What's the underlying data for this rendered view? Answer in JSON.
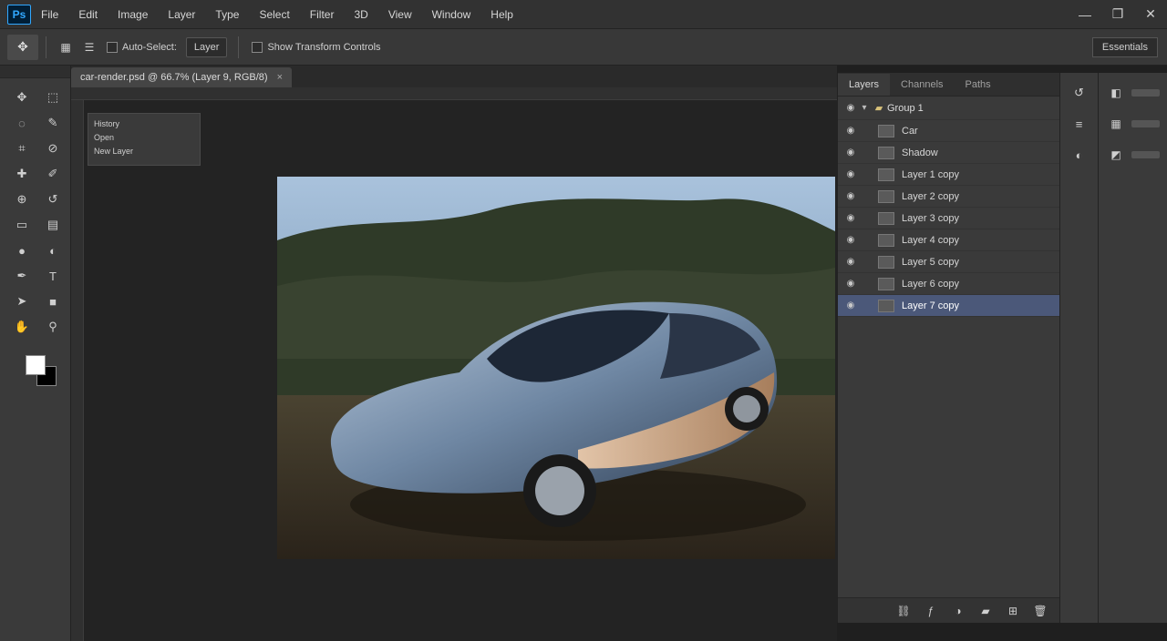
{
  "app": {
    "logo": "Ps"
  },
  "menu": [
    "File",
    "Edit",
    "Image",
    "Layer",
    "Type",
    "Select",
    "Filter",
    "3D",
    "View",
    "Window",
    "Help"
  ],
  "window_controls": {
    "minimize": "—",
    "maximize": "❐",
    "close": "✕"
  },
  "options_bar": {
    "tool_icon": "move-tool-icon",
    "auto_select_label": "Auto-Select:",
    "auto_select_value": "Layer",
    "transform_label": "Show Transform Controls",
    "workspace": "Essentials"
  },
  "document": {
    "tab_title": "car-render.psd @ 66.7% (Layer 9, RGB/8)",
    "close": "×"
  },
  "history_float": {
    "rows": [
      "History",
      "Open",
      "New Layer"
    ]
  },
  "layers_panel": {
    "tabs": [
      "Layers",
      "Channels",
      "Paths"
    ],
    "group_name": "Group 1",
    "layers": [
      "Car",
      "Shadow",
      "Layer 1 copy",
      "Layer 2 copy",
      "Layer 3 copy",
      "Layer 4 copy",
      "Layer 5 copy",
      "Layer 6 copy",
      "Layer 7 copy"
    ],
    "active_index": 8
  },
  "colors": {
    "foreground": "#ffffff",
    "background": "#000000",
    "selection": "#4b5879",
    "sky": "#8fb0d0",
    "hill": "#2f3a28",
    "car_body": "#8a9fb8",
    "car_side": "#c9a27c",
    "ground": "#3b3426"
  },
  "icons": {
    "tools": [
      "move-icon",
      "marquee-icon",
      "lasso-icon",
      "quick-select-icon",
      "crop-icon",
      "eyedropper-icon",
      "healing-icon",
      "brush-icon",
      "clone-icon",
      "history-brush-icon",
      "eraser-icon",
      "gradient-icon",
      "blur-icon",
      "dodge-icon",
      "pen-icon",
      "type-icon",
      "path-select-icon",
      "shape-icon",
      "hand-icon",
      "zoom-icon"
    ],
    "layer_footer": [
      "link-icon",
      "fx-icon",
      "mask-icon",
      "adjust-icon",
      "folder-icon",
      "new-layer-icon",
      "trash-icon"
    ]
  }
}
